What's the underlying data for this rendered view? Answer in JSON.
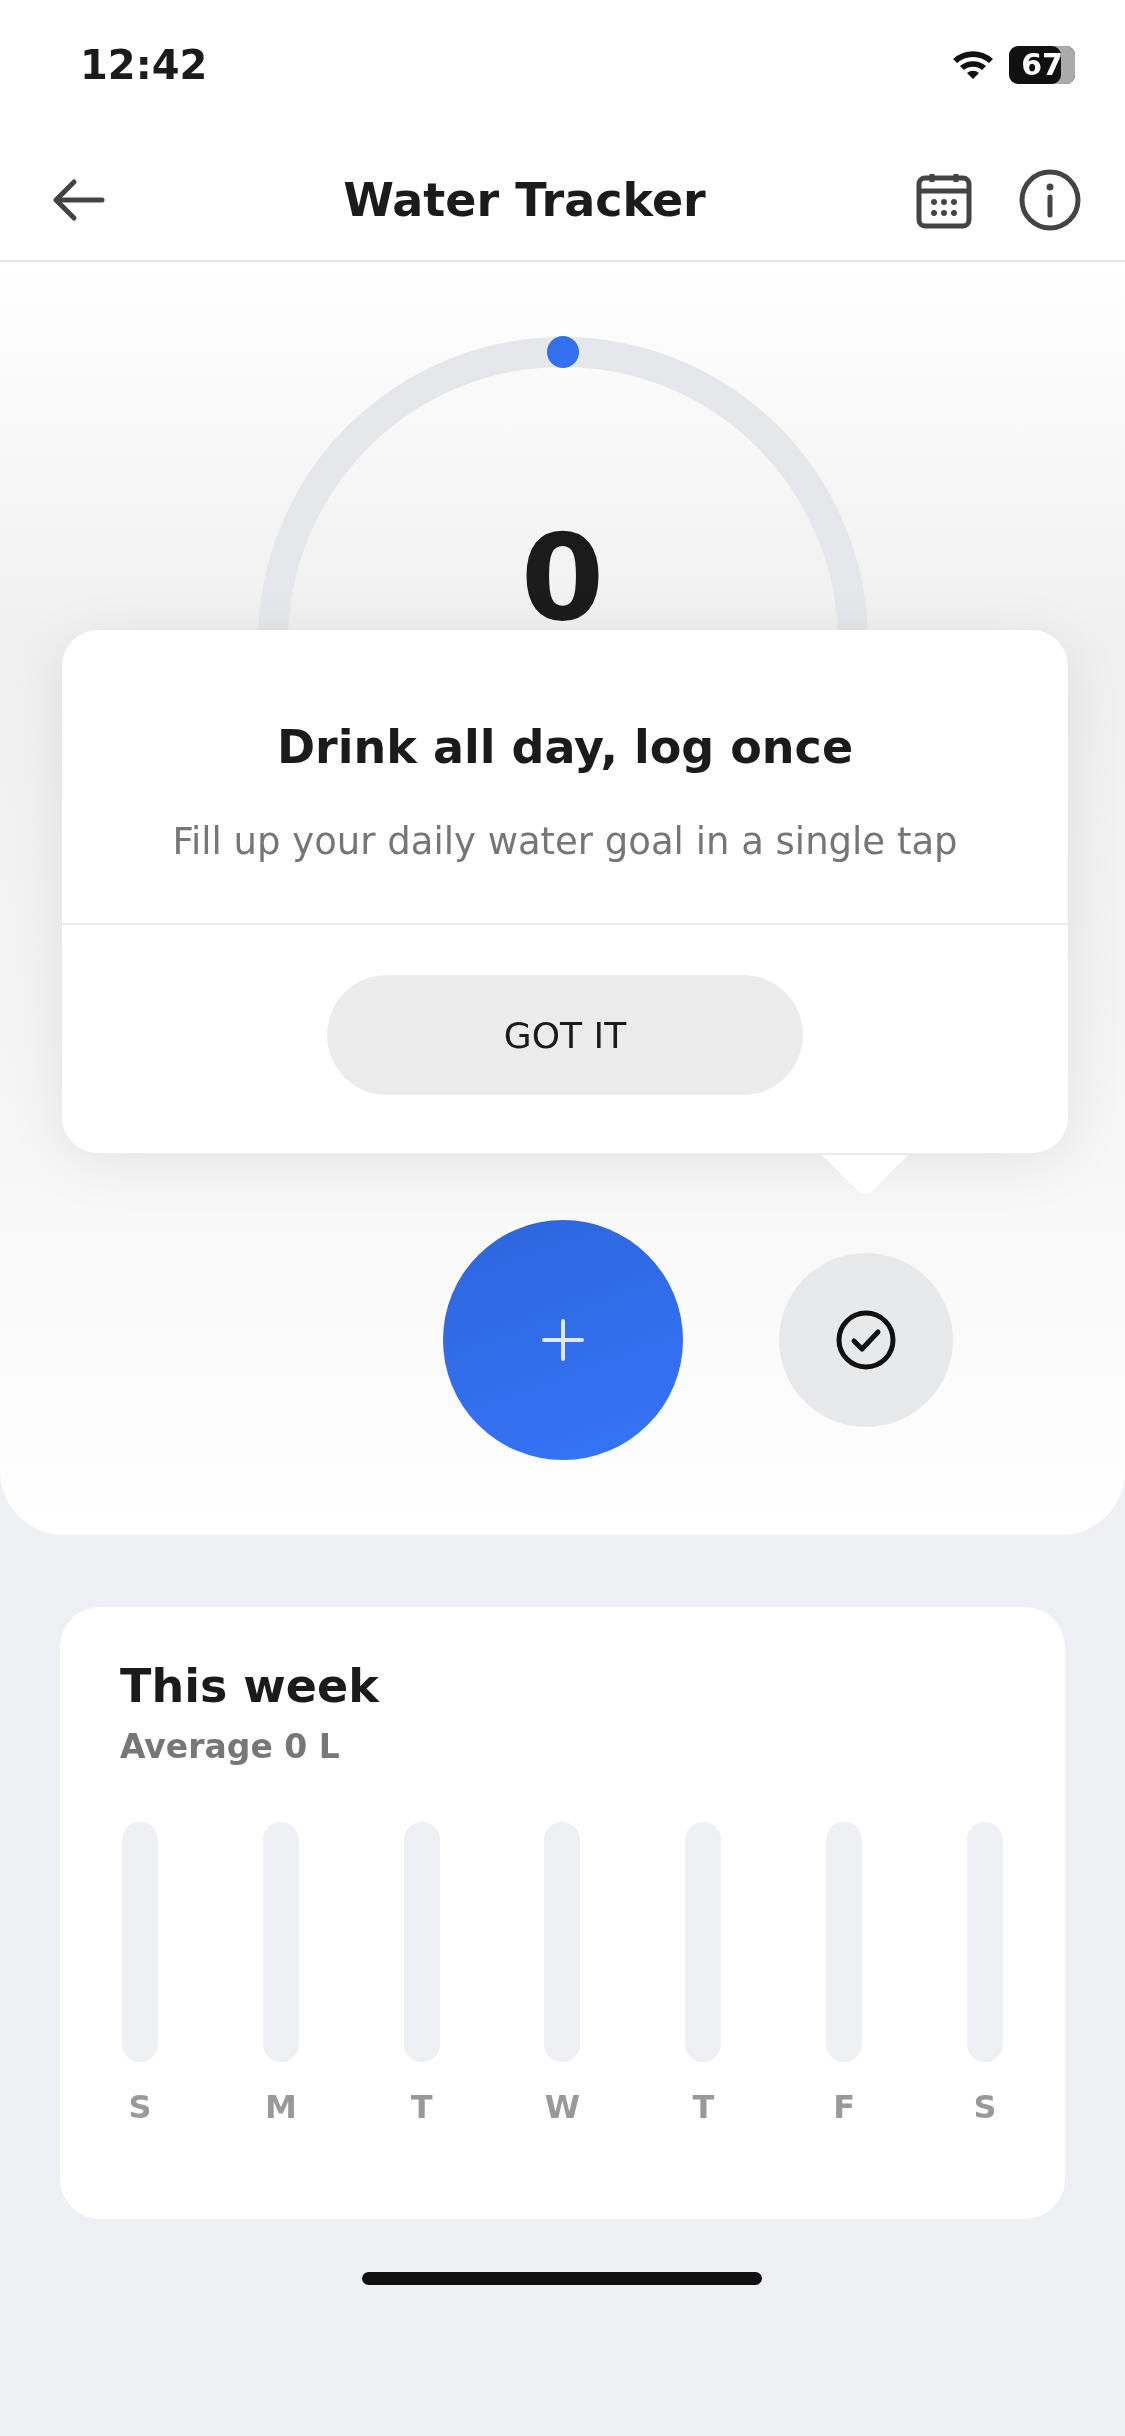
{
  "status_bar": {
    "time": "12:42",
    "battery": "67"
  },
  "header": {
    "title": "Water Tracker"
  },
  "gauge": {
    "value": "0"
  },
  "popover": {
    "title": "Drink all day, log once",
    "message": "Fill up your daily water goal in a single tap",
    "button": "GOT IT"
  },
  "week": {
    "title": "This week",
    "subtitle": "Average 0 L",
    "days": [
      {
        "label": "S"
      },
      {
        "label": "M"
      },
      {
        "label": "T"
      },
      {
        "label": "W"
      },
      {
        "label": "T"
      },
      {
        "label": "F"
      },
      {
        "label": "S"
      }
    ]
  }
}
